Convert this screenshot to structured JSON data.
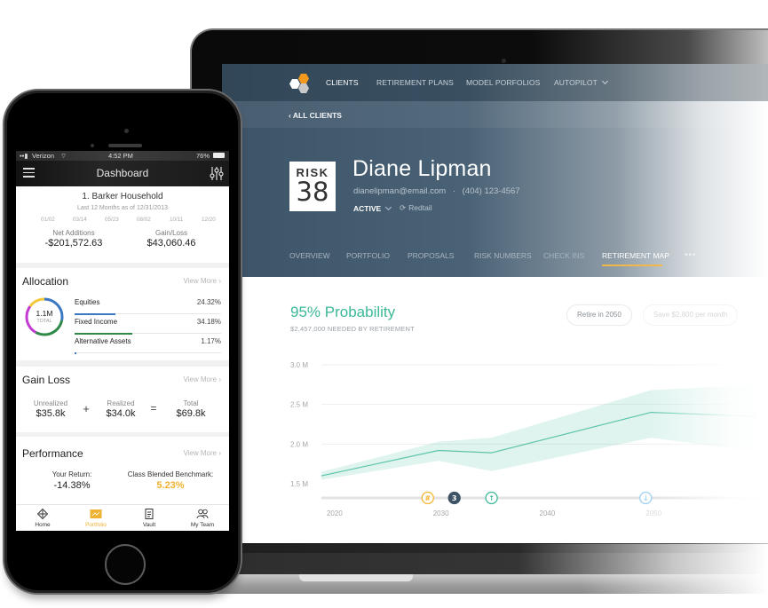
{
  "laptop": {
    "nav": {
      "items": [
        {
          "label": "CLIENTS",
          "active": true
        },
        {
          "label": "RETIREMENT PLANS",
          "active": false
        },
        {
          "label": "MODEL PORFOLIOS",
          "active": false
        },
        {
          "label": "AUTOPILOT",
          "active": false,
          "has_dropdown": true
        }
      ],
      "logo_colors": [
        "#ffffff",
        "#f39a1e",
        "#c8c8c8"
      ]
    },
    "back_link": "‹ ALL CLIENTS",
    "client": {
      "risk_label": "RISK",
      "risk_number": "38",
      "name": "Diane Lipman",
      "email": "dianelipman@email.com",
      "separator": "·",
      "phone": "(404) 123-4567",
      "status": "ACTIVE",
      "integration": "Redtail"
    },
    "tabs": [
      {
        "label": "OVERVIEW",
        "active": false
      },
      {
        "label": "PORTFOLIO",
        "active": false
      },
      {
        "label": "PROPOSALS",
        "active": false
      },
      {
        "label": "RISK NUMBERS",
        "active": false
      },
      {
        "label": "CHECK INS",
        "active": false
      },
      {
        "label": "RETIREMENT MAP",
        "active": true
      }
    ],
    "tabs_more": "•••",
    "retirement": {
      "probability_title": "95% Probability",
      "needed_subtitle": "$2,457,000 NEEDED BY RETIREMENT",
      "pills": [
        "Retire in 2050",
        "Save $2,800 per month"
      ]
    },
    "chart_data": {
      "type": "area",
      "title": "",
      "xlabel": "",
      "ylabel": "",
      "y_ticks": [
        "3.0 M",
        "2.5 M",
        "2.0 M",
        "1.5 M"
      ],
      "x_ticks": [
        "2020",
        "2030",
        "2040",
        "2050"
      ],
      "ylim": [
        1.5,
        3.0
      ],
      "xlim": [
        2019,
        2061
      ],
      "grid": true,
      "accent": "#3bb899",
      "x": [
        2019,
        2030,
        2035,
        2050,
        2060
      ],
      "series": [
        {
          "name": "median",
          "values": [
            1.6,
            1.92,
            1.89,
            2.4,
            2.35
          ]
        },
        {
          "name": "upper",
          "values": [
            1.65,
            2.03,
            2.08,
            2.68,
            2.75
          ]
        },
        {
          "name": "lower",
          "values": [
            1.55,
            1.79,
            1.66,
            2.08,
            1.9
          ]
        }
      ],
      "timeline_markers": [
        {
          "year": 2029,
          "type": "hash",
          "label": "#",
          "color": "#f3b431"
        },
        {
          "year": 2031.5,
          "type": "count",
          "label": "3",
          "color": "#3e5366"
        },
        {
          "year": 2035,
          "type": "up-arrow",
          "label": "↑",
          "color": "#3bb899"
        },
        {
          "year": 2049.5,
          "type": "down-arrow",
          "label": "↓",
          "color": "#9ccff0"
        }
      ]
    }
  },
  "phone": {
    "status_bar": {
      "carrier": "Verizon",
      "time": "4:52 PM",
      "battery": "76%"
    },
    "app_title": "Dashboard",
    "household": {
      "name": "1. Barker Household",
      "subtitle": "Last 12 Months as of 12/31/2013",
      "dates": [
        "01/02",
        "03/14",
        "05/23",
        "08/02",
        "10/11",
        "12/20"
      ],
      "net_additions_label": "Net Additions",
      "net_additions_value": "-$201,572.63",
      "gain_loss_label": "Gain/Loss",
      "gain_loss_value": "$43,060.46"
    },
    "allocation": {
      "title": "Allocation",
      "view_more": "View More",
      "total_value": "1.1M",
      "total_label": "TOTAL",
      "items": [
        {
          "label": "Equities",
          "pct": "24.32%",
          "fraction": 0.2432,
          "color": "#3a78c3"
        },
        {
          "label": "Fixed Income",
          "pct": "34.18%",
          "fraction": 0.3418,
          "color": "#2f8a47"
        },
        {
          "label": "Alternative Assets",
          "pct": "1.17%",
          "fraction": 0.0117,
          "color": "#3a78c3"
        }
      ],
      "ring_colors": [
        "#3a78c3",
        "#2f8a47",
        "#c23ad2",
        "#f2c73a"
      ]
    },
    "gain_loss": {
      "title": "Gain Loss",
      "view_more": "View More",
      "unrealized_label": "Unrealized",
      "unrealized_value": "$35.8k",
      "plus": "+",
      "realized_label": "Realized",
      "realized_value": "$34.0k",
      "equals": "=",
      "total_label": "Total",
      "total_value": "$69.8k"
    },
    "performance": {
      "title": "Performance",
      "view_more": "View More",
      "your_return_label": "Your Return:",
      "your_return_value": "-14.38%",
      "benchmark_label": "Class Blended Benchmark:",
      "benchmark_value": "5.23%",
      "benchmark_color": "#f0b232"
    },
    "tabbar": [
      {
        "label": "Home",
        "icon": "home-diamond-icon",
        "active": false
      },
      {
        "label": "Portfolio",
        "icon": "portfolio-chart-icon",
        "active": true
      },
      {
        "label": "Vault",
        "icon": "vault-document-icon",
        "active": false
      },
      {
        "label": "My Team",
        "icon": "team-people-icon",
        "active": false
      }
    ]
  }
}
